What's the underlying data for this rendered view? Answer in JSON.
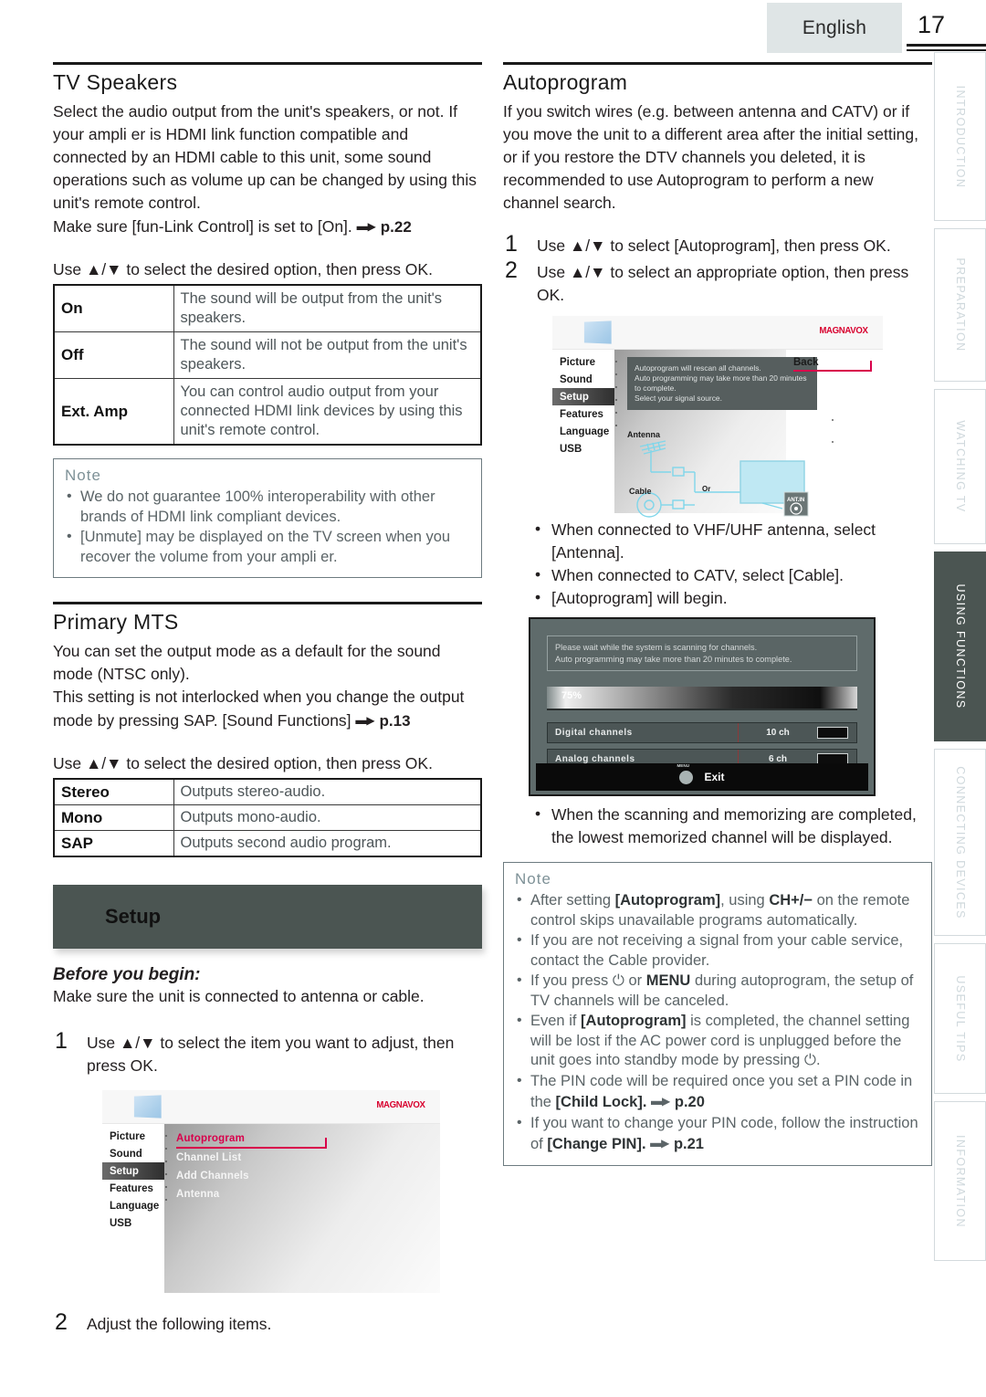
{
  "header": {
    "language_label": "English",
    "page_number": "17"
  },
  "left_column": {
    "tv_speakers": {
      "title": "TV Speakers",
      "body_1": "Select the audio output from the unit's speakers, or not. If your ampli er is HDMI link function compatible and connected by an HDMI cable to this unit, some sound operations such as volume up can be changed by using this unit's remote control.",
      "body_2_pre": "Make sure [fun-Link Control] is set to [On].",
      "body_2_ref": "p.22",
      "instruction": "Use ▲/▼ to select the desired option, then press OK.",
      "table": [
        {
          "key": "On",
          "value": "The sound will be output from the unit's speakers."
        },
        {
          "key": "Off",
          "value": "The sound will not be output from the unit's speakers."
        },
        {
          "key": "Ext. Amp",
          "value": "You can control audio output from your connected HDMI link devices by using this unit's remote control."
        }
      ],
      "note": {
        "title": "Note",
        "items": [
          "We do not guarantee 100% interoperability with other brands of HDMI link compliant devices.",
          "[Unmute] may be displayed on the TV screen when you recover the volume from your ampli er."
        ]
      }
    },
    "primary_mts": {
      "title": "Primary MTS",
      "body_1": "You can set the output mode as a default for the sound mode (NTSC only).",
      "body_2_pre": "This setting is not interlocked when you change the output mode by pressing SAP. [Sound Functions]",
      "body_2_ref": "p.13",
      "instruction": "Use ▲/▼ to select the desired option, then press OK.",
      "table": [
        {
          "key": "Stereo",
          "value": "Outputs stereo-audio."
        },
        {
          "key": "Mono",
          "value": "Outputs mono-audio."
        },
        {
          "key": "SAP",
          "value": "Outputs second audio program."
        }
      ]
    },
    "setup": {
      "banner_label": "Setup",
      "before_you_begin_title": "Before you begin:",
      "before_you_begin_text": "Make sure the unit is connected to antenna or cable.",
      "step_1_num": "1",
      "step_1_text": "Use ▲/▼ to select the item you want to adjust, then press OK.",
      "step_2_num": "2",
      "step_2_text": "Adjust the following items."
    },
    "osd_menu": {
      "brand": "MAGNAVOX",
      "nav": [
        "Picture",
        "Sound",
        "Setup",
        "Features",
        "Language",
        "USB"
      ],
      "nav_selected": "Setup",
      "items": [
        "Autoprogram",
        "Channel List",
        "Add Channels",
        "Antenna"
      ],
      "item_highlighted": "Autoprogram"
    }
  },
  "right_column": {
    "autoprogram": {
      "title": "Autoprogram",
      "body_1": "If you switch wires (e.g. between antenna and CATV) or if you move the unit to a different area after the initial setting, or if you restore the DTV channels you deleted, it is recommended to use Autoprogram to perform a new channel search.",
      "step_1_num": "1",
      "step_1_text": "Use ▲/▼ to select [Autoprogram], then press OK.",
      "step_2_num": "2",
      "step_2_text": "Use ▲/▼ to select an appropriate option, then press OK.",
      "bullets": [
        "When connected to VHF/UHF antenna, select [Antenna].",
        "When connected to CATV, select [Cable].",
        "[Autoprogram] will begin."
      ],
      "bullet_after_scan": "When the scanning and memorizing are completed, the lowest memorized channel will be displayed.",
      "note": {
        "title": "Note",
        "items": [
          {
            "text_before": "After setting ",
            "bold": "[Autoprogram]",
            "text_mid": ", using ",
            "bold2": "CH+/−",
            "text_after": " on the remote control skips unavailable programs automatically."
          },
          {
            "plain": "If you are not receiving a signal from your cable service, contact the Cable provider."
          },
          {
            "text_before": "If you press ⏻ or ",
            "bold": "MENU",
            "text_after": " during autoprogram, the setup of TV channels will be canceled."
          },
          {
            "text_before": "Even if ",
            "bold": "[Autoprogram]",
            "text_after": " is completed, the channel setting will be lost if the AC power cord is unplugged before the unit goes into standby mode by pressing ⏻."
          },
          {
            "text_before": "The PIN code will be required once you set a PIN code in the ",
            "bold": "[Child Lock].",
            "ref": "p.20"
          },
          {
            "text_before": "If you want to change your PIN code, follow the instruction of ",
            "bold": "[Change PIN].",
            "ref": "p.21"
          }
        ]
      }
    },
    "osd_autoprogram": {
      "brand": "MAGNAVOX",
      "nav": [
        "Picture",
        "Sound",
        "Setup",
        "Features",
        "Language",
        "USB"
      ],
      "nav_selected": "Setup",
      "message": "Autoprogram will rescan all channels.\nAuto programming may take more than 20 minutes to complete.\nSelect your signal source.",
      "back_label": "Back",
      "diagram_antenna_label": "Antenna",
      "diagram_cable_label": "Cable",
      "diagram_or_label": "Or",
      "diagram_port_label": "ANT.IN"
    },
    "osd_scanning": {
      "message": "Please wait while the system is scanning for channels.\nAuto programming may take more than 20 minutes to complete.",
      "progress_percent": "75%",
      "rows": [
        {
          "label": "Digital channels",
          "count": "10 ch"
        },
        {
          "label": "Analog channels",
          "count": "6 ch"
        }
      ],
      "exit_label": "Exit",
      "menu_button_label": "MENU"
    }
  },
  "side_tabs": [
    {
      "label": "INTRODUCTION",
      "active": false
    },
    {
      "label": "PREPARATION",
      "active": false
    },
    {
      "label": "WATCHING TV",
      "active": false
    },
    {
      "label": "USING FUNCTIONS",
      "active": true
    },
    {
      "label": "CONNECTING DEVICES",
      "active": false
    },
    {
      "label": "USEFUL TIPS",
      "active": false
    },
    {
      "label": "INFORMATION",
      "active": false
    }
  ],
  "colors": {
    "banner": "#4b5552",
    "accent_red": "#d8004b",
    "brand_red": "#d8002e",
    "note_text": "#5b6467",
    "tab_inactive_text": "#cfd8dc"
  }
}
